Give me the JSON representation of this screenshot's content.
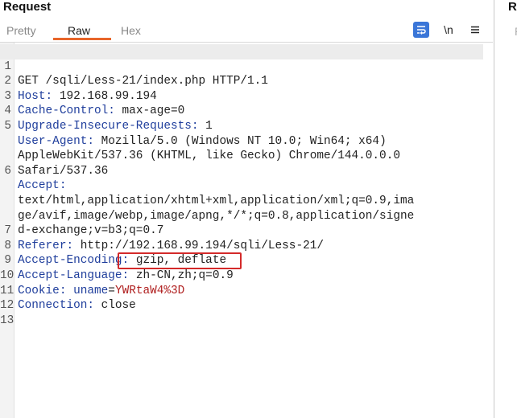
{
  "panel": {
    "title": "Request",
    "right_title": "R",
    "right_tab": "P"
  },
  "tabs": [
    {
      "label": "Pretty",
      "active": false
    },
    {
      "label": "Raw",
      "active": true
    },
    {
      "label": "Hex",
      "active": false
    }
  ],
  "toolbar": {
    "newline_label": "\\n",
    "wrap_icon": "wrap-lines-icon",
    "menu_icon": "hamburger-menu-icon"
  },
  "lines": [
    {
      "n": "1",
      "text": "GET /sqli/Less-21/index.php HTTP/1.1"
    },
    {
      "n": "2",
      "name": "Host",
      "value": " 192.168.99.194"
    },
    {
      "n": "3",
      "name": "Cache-Control",
      "value": " max-age=0"
    },
    {
      "n": "4",
      "name": "Upgrade-Insecure-Requests",
      "value": " 1"
    },
    {
      "n": "5",
      "name": "User-Agent",
      "value": " Mozilla/5.0 (Windows NT 10.0; Win64; x64)"
    },
    {
      "n": "",
      "text": "AppleWebKit/537.36 (KHTML, like Gecko) Chrome/144.0.0.0"
    },
    {
      "n": "",
      "text": "Safari/537.36"
    },
    {
      "n": "6",
      "name": "Accept",
      "value": ""
    },
    {
      "n": "",
      "text": "text/html,application/xhtml+xml,application/xml;q=0.9,ima"
    },
    {
      "n": "",
      "text": "ge/avif,image/webp,image/apng,*/*;q=0.8,application/signe"
    },
    {
      "n": "",
      "text": "d-exchange;v=b3;q=0.7"
    },
    {
      "n": "7",
      "name": "Referer",
      "value": " http://192.168.99.194/sqli/Less-21/"
    },
    {
      "n": "8",
      "name": "Accept-Encoding",
      "value": " gzip, deflate"
    },
    {
      "n": "9",
      "name": "Accept-Language",
      "value": " zh-CN,zh;q=0.9"
    },
    {
      "n": "10",
      "name": "Cookie",
      "value": " ",
      "cookie_name": "uname",
      "cookie_eq": "=",
      "cookie_value": "YWRtaW4%3D"
    },
    {
      "n": "11",
      "name": "Connection",
      "value": " close"
    },
    {
      "n": "12",
      "text": ""
    },
    {
      "n": "13",
      "text": ""
    }
  ]
}
